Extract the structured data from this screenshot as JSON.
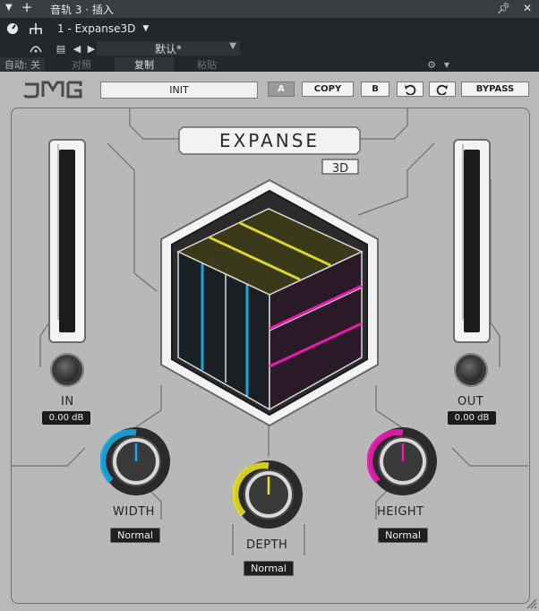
{
  "host": {
    "title": "音轨 3 · 插入",
    "plugin_name": "1 - Expanse3D",
    "preset": "默认*",
    "auto_label": "自动: 关",
    "compare_label": "对照",
    "copy_label": "复制",
    "paste_label": "粘贴"
  },
  "plugin": {
    "brand": "JMG",
    "preset_name": "INIT",
    "buttons": {
      "a": "A",
      "copy": "COPY",
      "b": "B",
      "bypass": "BYPASS"
    },
    "title_main": "EXPANSE",
    "title_sub": "3D",
    "in_label": "IN",
    "in_value": "0.00 dB",
    "out_label": "OUT",
    "out_value": "0.00 dB",
    "width_label": "WIDTH",
    "width_mode": "Normal",
    "depth_label": "DEPTH",
    "depth_mode": "Normal",
    "height_label": "HEIGHT",
    "height_mode": "Normal"
  },
  "colors": {
    "width_accent": "#1aa6e0",
    "depth_accent": "#e6e01c",
    "height_accent": "#e81bb0",
    "host_power": "#1f7fd0"
  }
}
